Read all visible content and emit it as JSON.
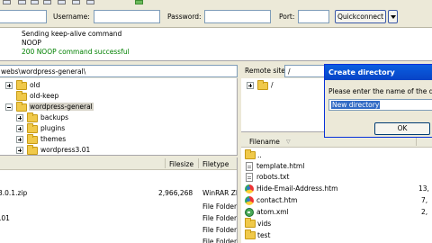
{
  "toolbar": {
    "icons": [
      "toolbar-icon-1",
      "toolbar-icon-2",
      "toolbar-icon-3",
      "toolbar-icon-4",
      "toolbar-icon-5",
      "toolbar-icon-6",
      "toolbar-icon-7"
    ]
  },
  "quickconnect": {
    "username_label": "Username:",
    "username_value": "",
    "password_label": "Password:",
    "password_value": "",
    "port_label": "Port:",
    "port_value": "",
    "button_label": "Quickconnect"
  },
  "log": {
    "lines": [
      "Sending keep-alive command",
      "NOOP",
      "200 NOOP command successful"
    ],
    "colors": [
      "#000000",
      "#000000",
      "#008000"
    ]
  },
  "local": {
    "path": "webs\\wordpress-general\\",
    "tree": [
      {
        "label": "old",
        "expandable": true
      },
      {
        "label": "old-keep",
        "expandable": false
      },
      {
        "label": "wordpress-general",
        "expandable": true,
        "selected": true
      },
      {
        "label": "backups",
        "expandable": true
      },
      {
        "label": "plugins",
        "expandable": true
      },
      {
        "label": "themes",
        "expandable": true
      },
      {
        "label": "wordpress3.01",
        "expandable": true
      }
    ],
    "columns": {
      "filesize": "Filesize",
      "filetype": "Filetype"
    },
    "files": [
      {
        "name": "",
        "size": "",
        "type": ""
      },
      {
        "name": "3.0.1.zip",
        "size": "2,966,268",
        "type": "WinRAR ZI"
      },
      {
        "name": "",
        "size": "",
        "type": "File Folder"
      },
      {
        "name": ".01",
        "size": "",
        "type": "File Folder"
      },
      {
        "name": "",
        "size": "",
        "type": "File Folder"
      },
      {
        "name": "",
        "size": "",
        "type": "File Folder"
      }
    ]
  },
  "remote": {
    "site_label": "Remote site:",
    "path": "/",
    "tree": [
      {
        "label": "/",
        "expandable": true
      }
    ],
    "columns": {
      "filename": "Filename",
      "sort_icon": "sort-indicator"
    },
    "files": [
      {
        "name": "..",
        "size": "",
        "icon": "folder"
      },
      {
        "name": "template.html",
        "size": "",
        "icon": "html-file"
      },
      {
        "name": "robots.txt",
        "size": "",
        "icon": "text-file"
      },
      {
        "name": "Hide-Email-Address.htm",
        "size": "13,",
        "icon": "chrome-file"
      },
      {
        "name": "contact.htm",
        "size": "7,",
        "icon": "chrome-file"
      },
      {
        "name": "atom.xml",
        "size": "2,",
        "icon": "xml-file"
      },
      {
        "name": "vids",
        "size": "",
        "icon": "folder"
      },
      {
        "name": "test",
        "size": "",
        "icon": "folder"
      }
    ]
  },
  "dialog": {
    "title": "Create directory",
    "prompt": "Please enter the name of the di",
    "input_value": "New directory",
    "ok_label": "OK"
  }
}
